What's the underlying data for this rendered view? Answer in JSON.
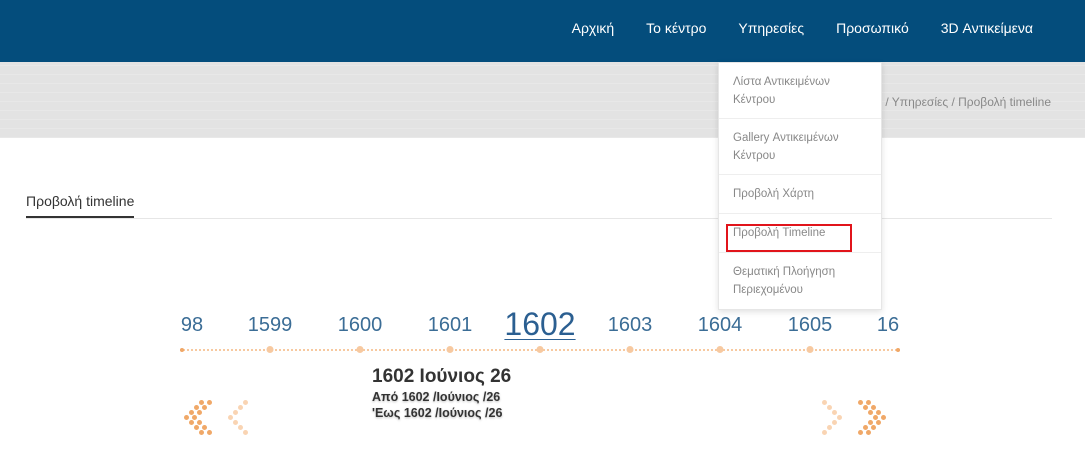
{
  "nav": {
    "items": [
      "Αρχική",
      "Το κέντρο",
      "Υπηρεσίες",
      "Προσωπικό",
      "3D Αντικείμενα"
    ]
  },
  "breadcrumb": "/ Υπηρεσίες / Προβολή timeline",
  "dropdown": {
    "items": [
      {
        "label": "Λίστα Αντικειμένων Κέντρου"
      },
      {
        "label": "Gallery Αντικειμένων Κέντρου"
      },
      {
        "label": "Προβολή Χάρτη"
      },
      {
        "label": "Προβολή Timeline",
        "highlighted": true
      },
      {
        "label": "Θεματική Πλοήγηση Περιεχομένου"
      }
    ]
  },
  "page_tab": "Προβολή timeline",
  "timeline": {
    "years": [
      "98",
      "1599",
      "1600",
      "1601",
      "1602",
      "1603",
      "1604",
      "1605",
      "16"
    ],
    "active": "1602"
  },
  "event": {
    "title": "1602 Ιούνιος 26",
    "from": "Από 1602 /Ιούνιος /26",
    "to": "'Εως 1602 /Ιούνιος /26"
  },
  "colors": {
    "nav_bg": "#044d7c",
    "highlight_border": "#e1141b",
    "timeline_accent": "#f0a868",
    "year_text": "#3b6d96"
  }
}
